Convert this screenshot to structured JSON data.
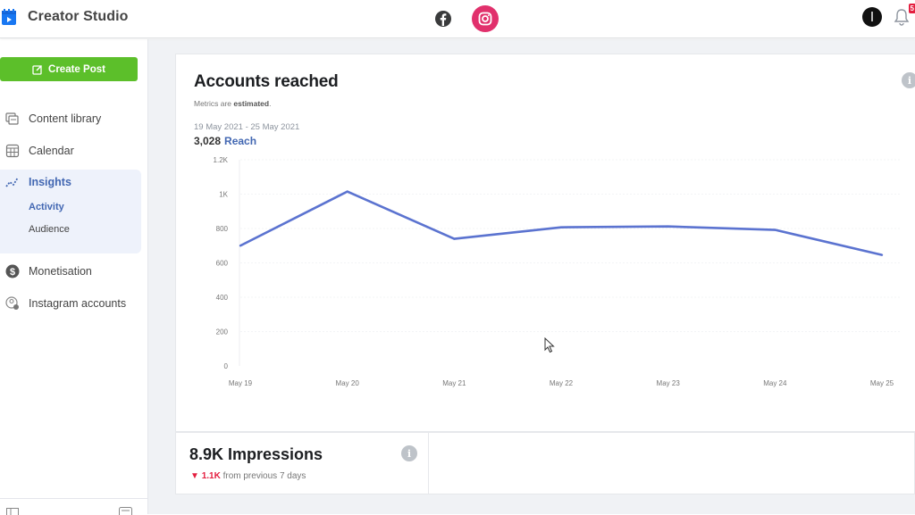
{
  "header": {
    "app_title": "Creator Studio",
    "app_icon": "clapperboard-icon",
    "platforms": [
      {
        "name": "Facebook",
        "icon": "facebook-icon",
        "active": false
      },
      {
        "name": "Instagram",
        "icon": "instagram-icon",
        "active": true,
        "color": "#e1306c"
      }
    ],
    "notification_count": "5"
  },
  "sidebar": {
    "create_button": "Create Post",
    "create_button_color": "#5cbf2a",
    "items": [
      {
        "label": "Content library",
        "icon": "content-library-icon"
      },
      {
        "label": "Calendar",
        "icon": "calendar-icon"
      },
      {
        "label": "Insights",
        "icon": "insights-icon",
        "active": true,
        "children": [
          {
            "label": "Activity",
            "active": true
          },
          {
            "label": "Audience",
            "active": false
          }
        ]
      },
      {
        "label": "Monetisation",
        "icon": "dollar-icon"
      },
      {
        "label": "Instagram accounts",
        "icon": "account-settings-icon"
      }
    ]
  },
  "main": {
    "reach_card": {
      "title": "Accounts reached",
      "note_prefix": "Metrics are ",
      "note_bold": "estimated",
      "note_suffix": ".",
      "date_range": "19 May 2021 - 25 May 2021",
      "total": "3,028",
      "total_label": "Reach"
    },
    "impressions_card": {
      "title": "8.9K Impressions",
      "delta": "1.1K",
      "delta_direction": "down",
      "delta_suffix": "from previous 7 days"
    }
  },
  "chart_data": {
    "type": "line",
    "title": "Accounts reached",
    "xlabel": "",
    "ylabel": "",
    "categories": [
      "May 19",
      "May 20",
      "May 21",
      "May 22",
      "May 23",
      "May 24",
      "May 25"
    ],
    "series": [
      {
        "name": "Reach",
        "color": "#5b73d0",
        "values": [
          700,
          1015,
          740,
          807,
          812,
          792,
          646
        ]
      }
    ],
    "ylim": [
      0,
      1200
    ],
    "yticks": [
      0,
      200,
      400,
      600,
      800,
      1000,
      1200
    ],
    "ytick_labels": [
      "0",
      "200",
      "400",
      "600",
      "800",
      "1K",
      "1.2K"
    ],
    "grid": true,
    "legend": "none"
  }
}
